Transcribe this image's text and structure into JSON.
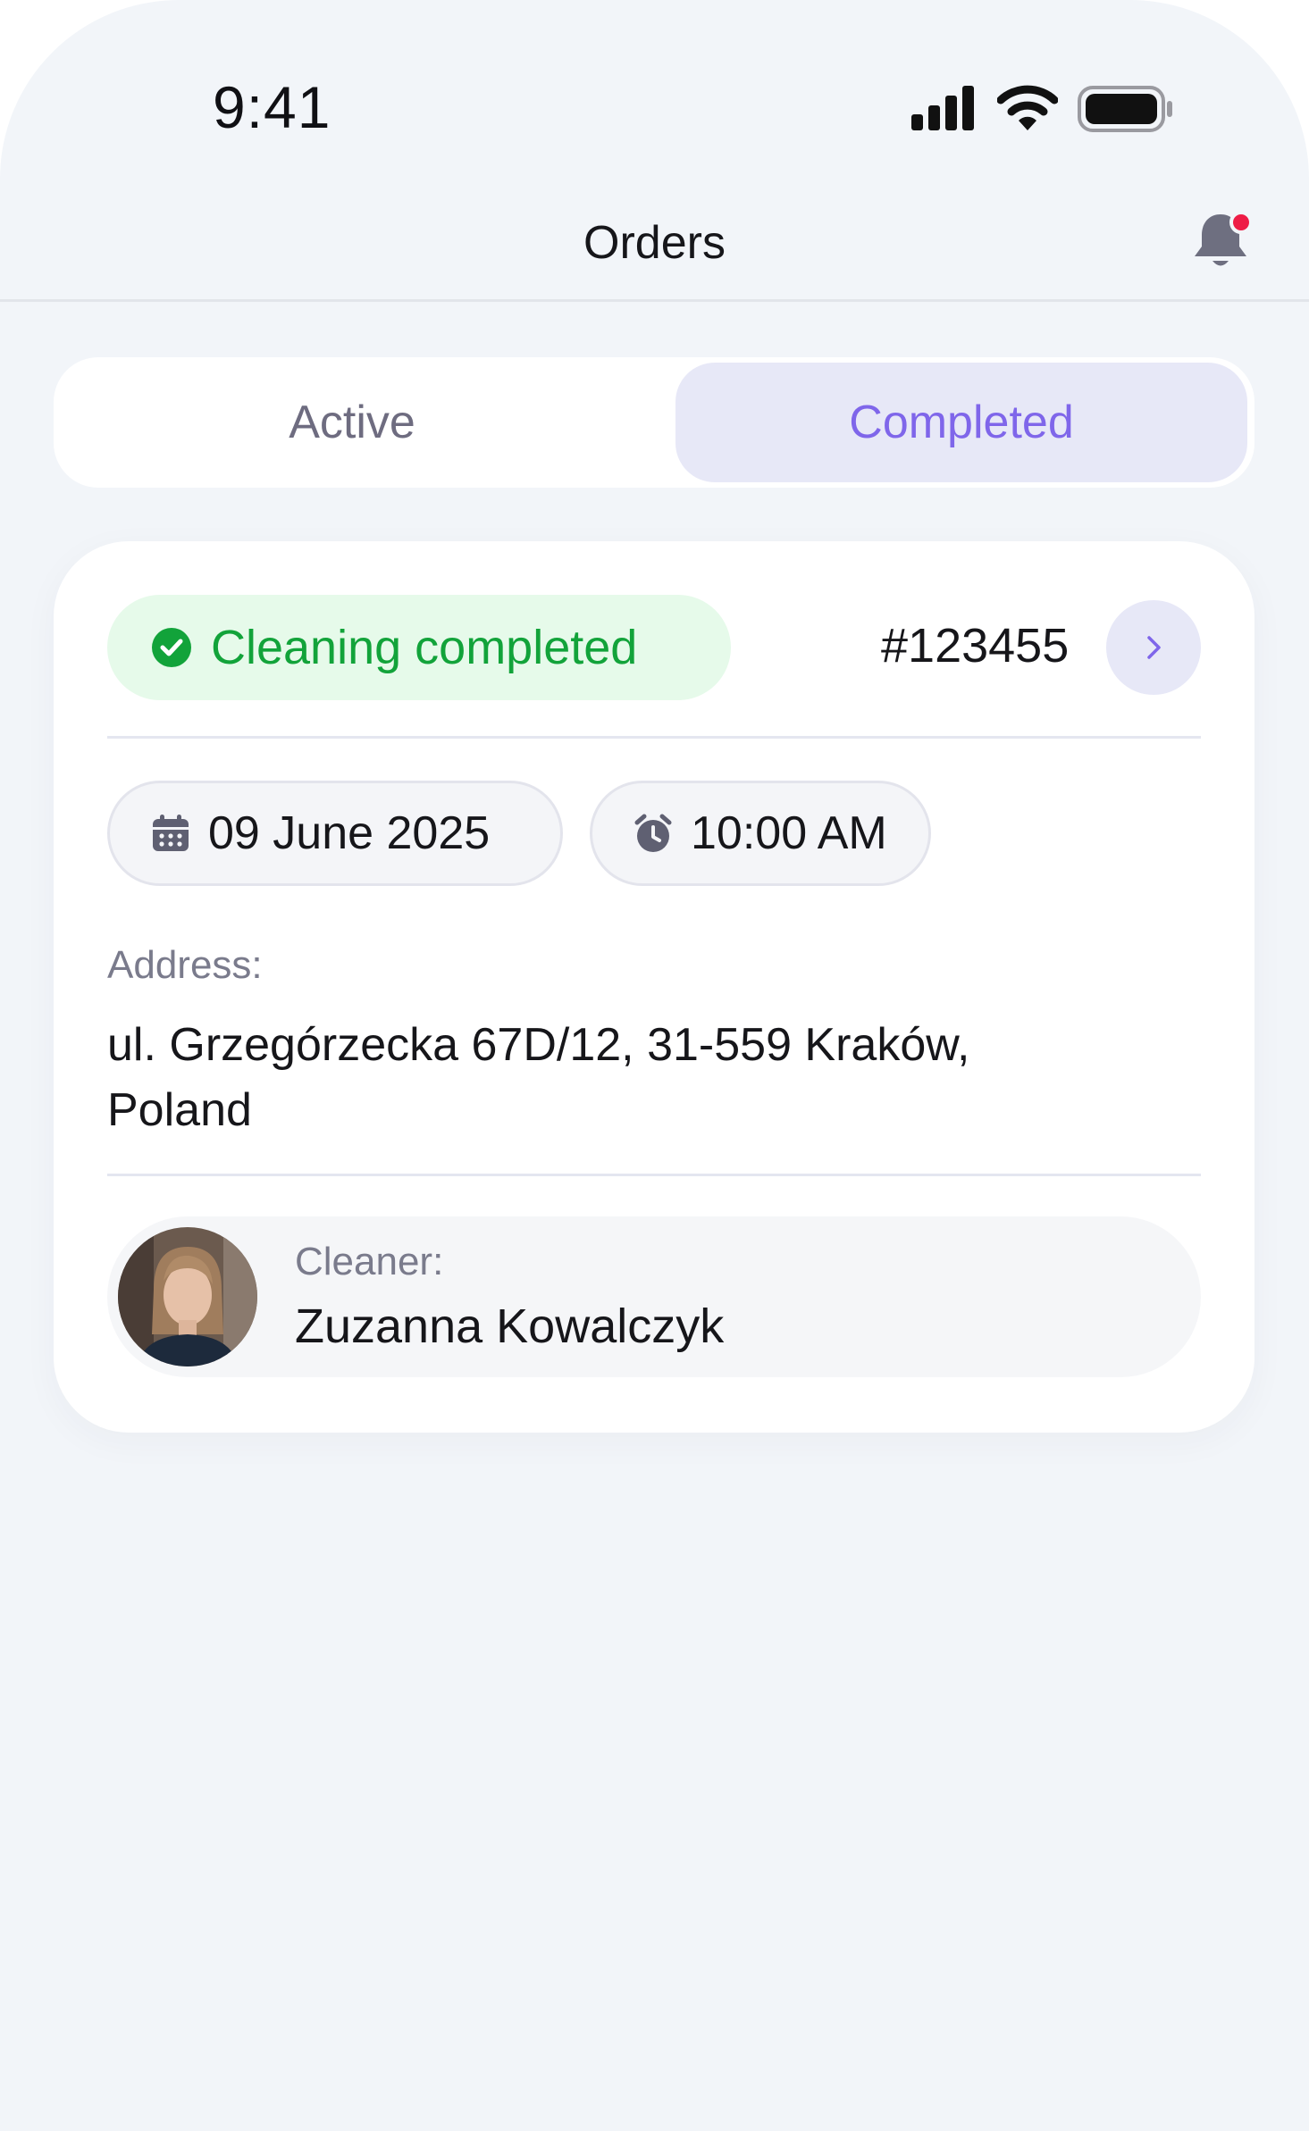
{
  "status_bar": {
    "time": "9:41"
  },
  "nav": {
    "title": "Orders"
  },
  "tabs": {
    "active_label": "Active",
    "completed_label": "Completed",
    "selected": "Completed"
  },
  "order": {
    "status": "Cleaning completed",
    "number": "#123455",
    "date": "09 June 2025",
    "time": "10:00 AM",
    "address_label": "Address:",
    "address_line1": "ul. Grzegórzecka 67D/12, 31-559 Kraków,",
    "address_line2": "Poland",
    "cleaner_label": "Cleaner:",
    "cleaner_name": "Zuzanna Kowalczyk"
  },
  "colors": {
    "accent": "#7f66ea",
    "success": "#12a33a",
    "notification_dot": "#ee1c46"
  },
  "icons": [
    "signal-icon",
    "wifi-icon",
    "battery-icon",
    "bell-icon",
    "check-circle-icon",
    "chevron-right-icon",
    "calendar-icon",
    "alarm-clock-icon"
  ]
}
